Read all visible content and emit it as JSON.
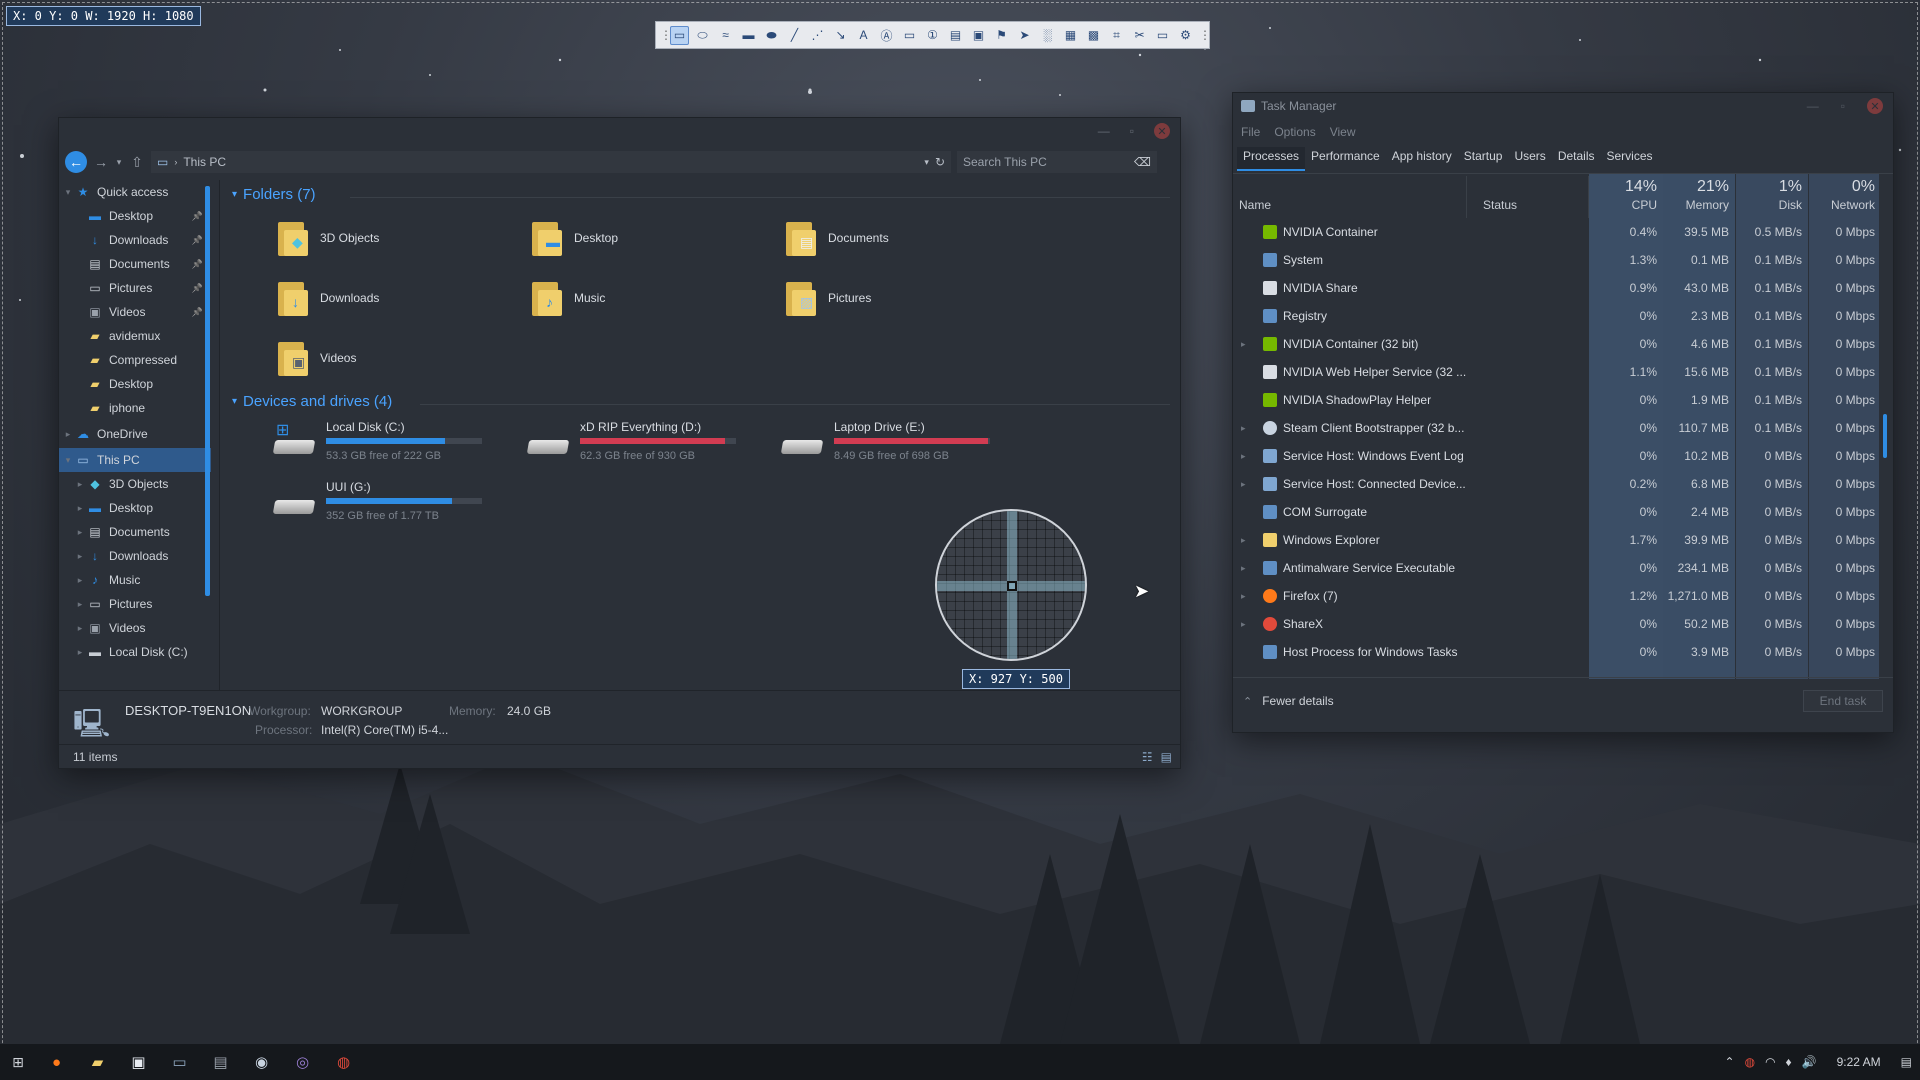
{
  "overlay": {
    "top_readout": "X: 0 Y: 0 W: 1920 H: 1080",
    "cursor_readout": "X: 927 Y: 500"
  },
  "capture_toolbar": {
    "icons": [
      "grip-icon",
      "rectangle-region-icon",
      "ellipse-region-icon",
      "freehand-region-icon",
      "fullscreen-icon",
      "window-icon",
      "line-icon",
      "dotted-line-icon",
      "arrow-line-icon",
      "text-icon",
      "text-outline-icon",
      "speech-bubble-icon",
      "step-counter-icon",
      "clipboard-icon",
      "highlight-icon",
      "marker-icon",
      "cursor-icon",
      "blur-icon",
      "grid-icon",
      "pixelate-icon",
      "crop-icon",
      "delete-icon",
      "image-options-icon",
      "settings-icon",
      "more-icon"
    ]
  },
  "explorer": {
    "path": "This PC",
    "search_placeholder": "Search This PC",
    "nav": [
      {
        "label": "Quick access",
        "icon": "star-icon",
        "level": 0,
        "exp": "▾"
      },
      {
        "label": "Desktop",
        "icon": "desktop-icon",
        "level": 1,
        "pin": true
      },
      {
        "label": "Downloads",
        "icon": "download-icon",
        "level": 1,
        "pin": true
      },
      {
        "label": "Documents",
        "icon": "document-icon",
        "level": 1,
        "pin": true
      },
      {
        "label": "Pictures",
        "icon": "picture-icon",
        "level": 1,
        "pin": true
      },
      {
        "label": "Videos",
        "icon": "video-icon",
        "level": 1,
        "pin": true
      },
      {
        "label": "avidemux",
        "icon": "folder-icon",
        "level": 1
      },
      {
        "label": "Compressed",
        "icon": "folder-icon",
        "level": 1
      },
      {
        "label": "Desktop",
        "icon": "folder-icon",
        "level": 1
      },
      {
        "label": "iphone",
        "icon": "folder-icon",
        "level": 1
      },
      {
        "label": "OneDrive",
        "icon": "cloud-icon",
        "level": 0,
        "exp": "▸"
      },
      {
        "label": "This PC",
        "icon": "computer-icon",
        "level": 0,
        "exp": "▾",
        "selected": true
      },
      {
        "label": "3D Objects",
        "icon": "cube-icon",
        "level": 1,
        "exp": "▸"
      },
      {
        "label": "Desktop",
        "icon": "desktop-icon",
        "level": 1,
        "exp": "▸"
      },
      {
        "label": "Documents",
        "icon": "document-icon",
        "level": 1,
        "exp": "▸"
      },
      {
        "label": "Downloads",
        "icon": "download-icon",
        "level": 1,
        "exp": "▸"
      },
      {
        "label": "Music",
        "icon": "music-icon",
        "level": 1,
        "exp": "▸"
      },
      {
        "label": "Pictures",
        "icon": "picture-icon",
        "level": 1,
        "exp": "▸"
      },
      {
        "label": "Videos",
        "icon": "video-icon",
        "level": 1,
        "exp": "▸"
      },
      {
        "label": "Local Disk (C:)",
        "icon": "drive-icon",
        "level": 1,
        "exp": "▸"
      }
    ],
    "folders_header": "Folders (7)",
    "folders": [
      {
        "label": "3D Objects",
        "icon": "cube-icon"
      },
      {
        "label": "Desktop",
        "icon": "desktop-icon"
      },
      {
        "label": "Documents",
        "icon": "document-icon"
      },
      {
        "label": "Downloads",
        "icon": "download-icon"
      },
      {
        "label": "Music",
        "icon": "music-icon"
      },
      {
        "label": "Pictures",
        "icon": "picture-icon"
      },
      {
        "label": "Videos",
        "icon": "video-icon"
      }
    ],
    "drives_header": "Devices and drives (4)",
    "drives": [
      {
        "label": "Local Disk (C:)",
        "free": "53.3 GB free of 222 GB",
        "used_fraction": 0.76,
        "color": "#2f8de4",
        "system": true
      },
      {
        "label": "xD RIP Everything (D:)",
        "free": "62.3 GB free of 930 GB",
        "used_fraction": 0.93,
        "color": "#d23c52"
      },
      {
        "label": "Laptop Drive (E:)",
        "free": "8.49 GB free of 698 GB",
        "used_fraction": 0.99,
        "color": "#d23c52"
      },
      {
        "label": "UUI (G:)",
        "free": "352 GB free of 1.77 TB",
        "used_fraction": 0.81,
        "color": "#2f8de4"
      }
    ],
    "details": {
      "computer_name": "DESKTOP-T9EN1ON",
      "workgroup_label": "Workgroup:",
      "workgroup": "WORKGROUP",
      "memory_label": "Memory:",
      "memory": "24.0 GB",
      "processor_label": "Processor:",
      "processor": "Intel(R) Core(TM) i5-4..."
    },
    "status": "11 items"
  },
  "taskmgr": {
    "title": "Task Manager",
    "menu": [
      "File",
      "Options",
      "View"
    ],
    "tabs": [
      "Processes",
      "Performance",
      "App history",
      "Startup",
      "Users",
      "Details",
      "Services"
    ],
    "columns": {
      "name": "Name",
      "status": "Status",
      "cpu_pct": "14%",
      "cpu": "CPU",
      "mem_pct": "21%",
      "mem": "Memory",
      "disk_pct": "1%",
      "disk": "Disk",
      "net_pct": "0%",
      "net": "Network"
    },
    "rows": [
      {
        "name": "NVIDIA Container",
        "icon": "nvidia-icon",
        "cpu": "0.4%",
        "mem": "39.5 MB",
        "disk": "0.5 MB/s",
        "net": "0 Mbps",
        "exp": false
      },
      {
        "name": "System",
        "icon": "system-icon",
        "cpu": "1.3%",
        "mem": "0.1 MB",
        "disk": "0.1 MB/s",
        "net": "0 Mbps",
        "exp": false
      },
      {
        "name": "NVIDIA Share",
        "icon": "nvidia-share-icon",
        "cpu": "0.9%",
        "mem": "43.0 MB",
        "disk": "0.1 MB/s",
        "net": "0 Mbps",
        "exp": false
      },
      {
        "name": "Registry",
        "icon": "system-icon",
        "cpu": "0%",
        "mem": "2.3 MB",
        "disk": "0.1 MB/s",
        "net": "0 Mbps",
        "exp": false
      },
      {
        "name": "NVIDIA Container (32 bit)",
        "icon": "nvidia-icon",
        "cpu": "0%",
        "mem": "4.6 MB",
        "disk": "0.1 MB/s",
        "net": "0 Mbps",
        "exp": true
      },
      {
        "name": "NVIDIA Web Helper Service (32 ...",
        "icon": "nvidia-share-icon",
        "cpu": "1.1%",
        "mem": "15.6 MB",
        "disk": "0.1 MB/s",
        "net": "0 Mbps",
        "exp": false
      },
      {
        "name": "NVIDIA ShadowPlay Helper",
        "icon": "nvidia-icon",
        "cpu": "0%",
        "mem": "1.9 MB",
        "disk": "0.1 MB/s",
        "net": "0 Mbps",
        "exp": false
      },
      {
        "name": "Steam Client Bootstrapper (32 b...",
        "icon": "steam-icon",
        "cpu": "0%",
        "mem": "110.7 MB",
        "disk": "0.1 MB/s",
        "net": "0 Mbps",
        "exp": true
      },
      {
        "name": "Service Host: Windows Event Log",
        "icon": "gear-icon",
        "cpu": "0%",
        "mem": "10.2 MB",
        "disk": "0 MB/s",
        "net": "0 Mbps",
        "exp": true
      },
      {
        "name": "Service Host: Connected Device...",
        "icon": "gear-icon",
        "cpu": "0.2%",
        "mem": "6.8 MB",
        "disk": "0 MB/s",
        "net": "0 Mbps",
        "exp": true
      },
      {
        "name": "COM Surrogate",
        "icon": "system-icon",
        "cpu": "0%",
        "mem": "2.4 MB",
        "disk": "0 MB/s",
        "net": "0 Mbps",
        "exp": false
      },
      {
        "name": "Windows Explorer",
        "icon": "folder-icon",
        "cpu": "1.7%",
        "mem": "39.9 MB",
        "disk": "0 MB/s",
        "net": "0 Mbps",
        "exp": true
      },
      {
        "name": "Antimalware Service Executable",
        "icon": "system-icon",
        "cpu": "0%",
        "mem": "234.1 MB",
        "disk": "0 MB/s",
        "net": "0 Mbps",
        "exp": true
      },
      {
        "name": "Firefox (7)",
        "icon": "firefox-icon",
        "cpu": "1.2%",
        "mem": "1,271.0 MB",
        "disk": "0 MB/s",
        "net": "0 Mbps",
        "exp": true
      },
      {
        "name": "ShareX",
        "icon": "sharex-icon",
        "cpu": "0%",
        "mem": "50.2 MB",
        "disk": "0 MB/s",
        "net": "0 Mbps",
        "exp": true
      },
      {
        "name": "Host Process for Windows Tasks",
        "icon": "system-icon",
        "cpu": "0%",
        "mem": "3.9 MB",
        "disk": "0 MB/s",
        "net": "0 Mbps",
        "exp": false
      }
    ],
    "fewer_details": "Fewer details",
    "end_task": "End task"
  },
  "taskbar": {
    "apps": [
      "firefox-icon",
      "file-explorer-icon",
      "store-icon",
      "terminal-icon",
      "network-monitor-icon",
      "steam-icon",
      "obs-icon",
      "sharex-icon"
    ],
    "tray_icons": [
      "chevron-up-icon",
      "sharex-tray-icon",
      "wifi-icon",
      "controller-icon",
      "volume-icon"
    ],
    "time": "9:22 AM"
  },
  "colors": {
    "accent": "#2f8de4",
    "drive_warning": "#d23c52",
    "selection": "#2f5a8c"
  }
}
